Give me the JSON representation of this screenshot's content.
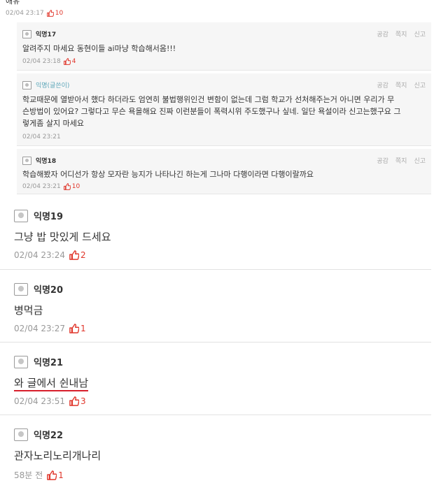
{
  "top": {
    "cut_text": "애유",
    "meta": {
      "time": "02/04 23:17",
      "likes": "10"
    }
  },
  "replies": [
    {
      "name": "익명17",
      "author": false,
      "actions": [
        "공감",
        "쪽지",
        "신고"
      ],
      "lines": [
        "알려주지 마세요 동현이들 ai마냥 학습해서옴!!!"
      ],
      "time": "02/04 23:18",
      "likes": "4"
    },
    {
      "name": "익명(글쓴이)",
      "author": true,
      "actions": [
        "공감",
        "쪽지",
        "신고"
      ],
      "lines": [
        "학교때문에 열받아서 했다 하더라도 엄연히 불법행위인건 변함이 없는데 그럼 학교가 선처해주는거 아니면 우리가 무",
        "슨방법이 있어요? 그렇다고 무슨 욕을해요 진짜 이런분들이 폭력시위 주도했구나 싶네. 일단 욕설이라 신고는했구요 그",
        "렇게좀 살지 마세요"
      ],
      "time": "02/04 23:21",
      "likes": ""
    },
    {
      "name": "익명18",
      "author": false,
      "actions": [
        "공감",
        "쪽지",
        "신고"
      ],
      "lines": [
        "학습해봤자 어디선가 항상 모자란 능지가 나타나긴 하는게 그나마 다행이라면 다행이랄까요"
      ],
      "time": "02/04 23:21",
      "likes": "10"
    }
  ],
  "posts": [
    {
      "name": "익명19",
      "text": "그냥 밥 맛있게 드세요",
      "time": "02/04 23:24",
      "likes": "2"
    },
    {
      "name": "익명20",
      "text": "병먹금",
      "time": "02/04 23:27",
      "likes": "1"
    },
    {
      "name": "익명21",
      "text": "와 글에서 쉰내남",
      "time": "02/04 23:51",
      "likes": "3"
    },
    {
      "name": "익명22",
      "text": "관자노리노리개나리",
      "time": "58분 전",
      "likes": "1"
    }
  ],
  "colors": {
    "like": "#e0362b",
    "author": "#5aa5b8",
    "underline": "#d81e2b"
  },
  "icons": {
    "like": "thumbs-up-icon",
    "avatar": "anonymous-avatar-icon"
  }
}
